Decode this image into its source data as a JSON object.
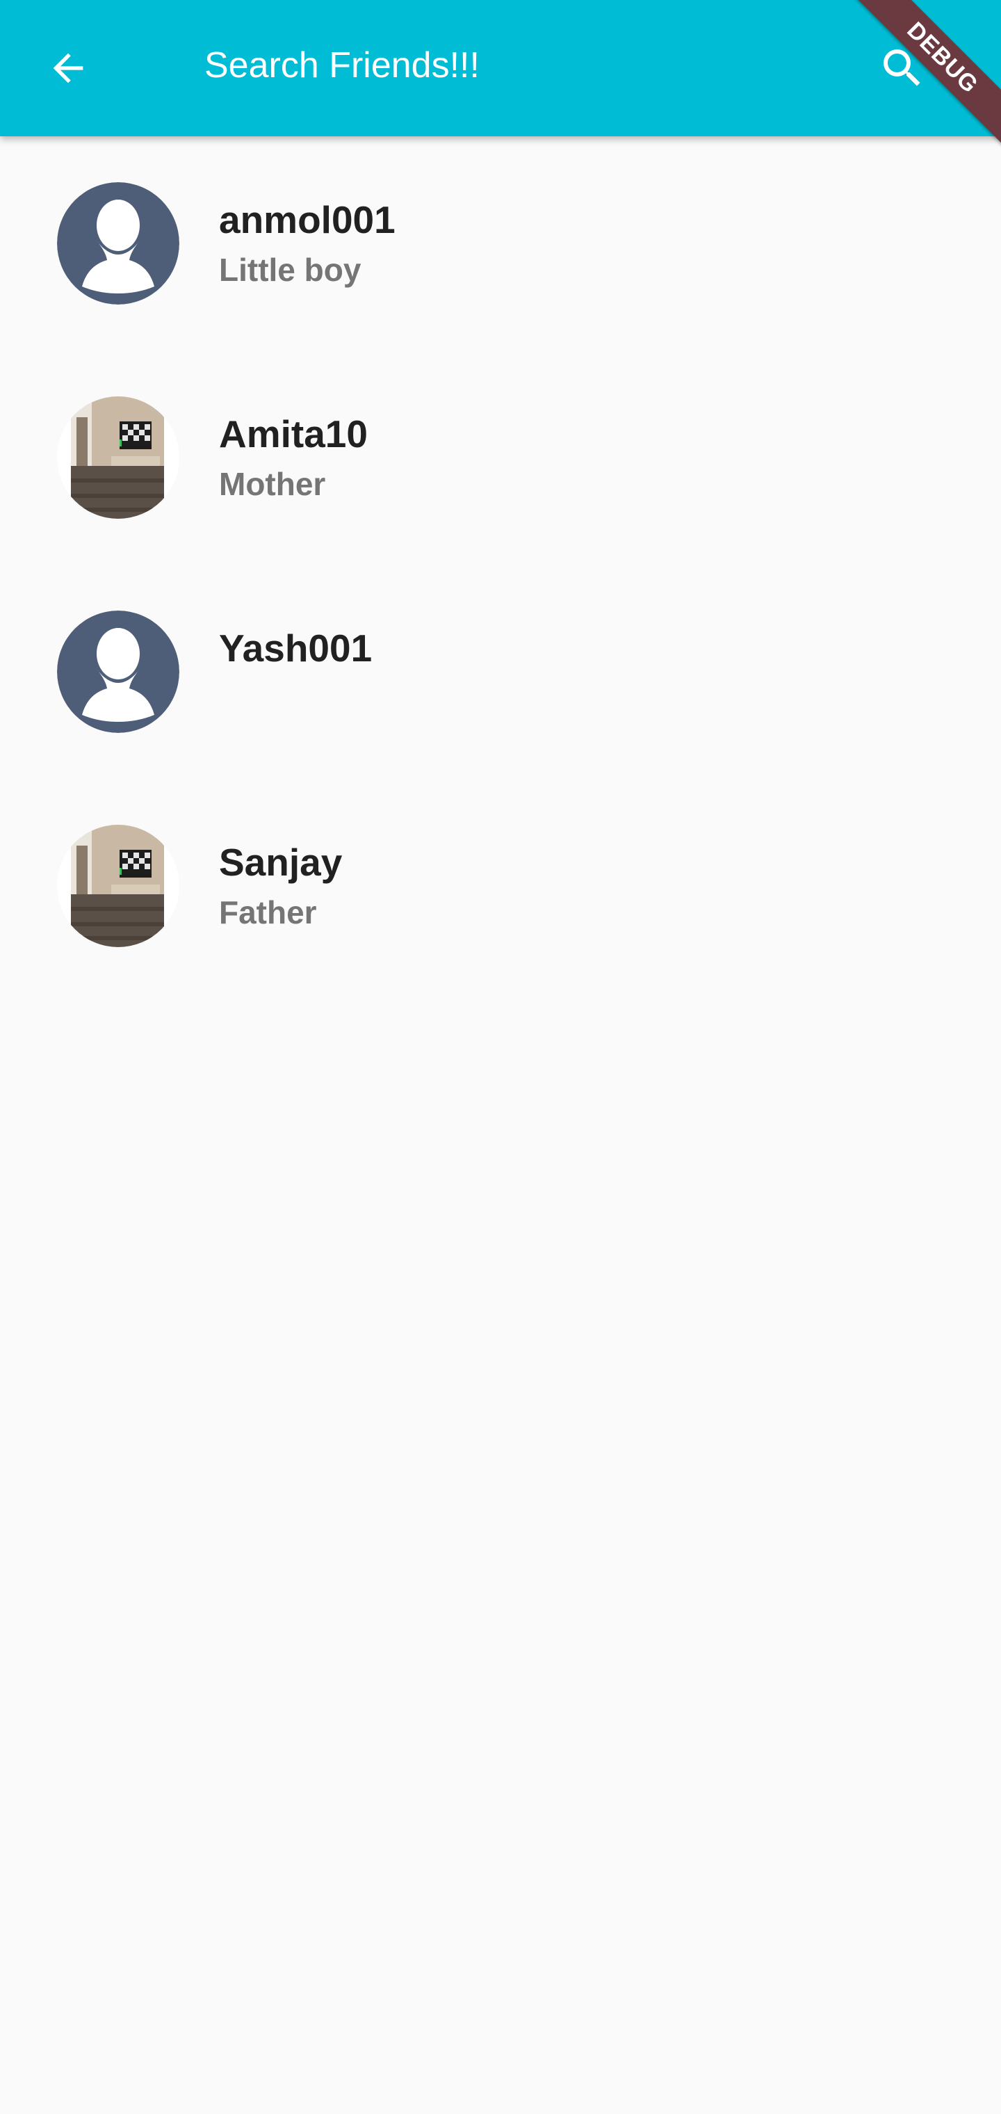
{
  "appbar": {
    "title": "Search Friends!!!",
    "back_icon": "arrow-back-icon",
    "search_icon": "search-icon",
    "color": "#00bcd4"
  },
  "debug_banner": {
    "label": "DEBUG"
  },
  "friends": [
    {
      "name": "anmol001",
      "relation": "Little boy",
      "avatar": "default-person-avatar"
    },
    {
      "name": "Amita10",
      "relation": "Mother",
      "avatar": "room-photo-avatar"
    },
    {
      "name": "Yash001",
      "relation": "",
      "avatar": "default-person-avatar"
    },
    {
      "name": "Sanjay",
      "relation": "Father",
      "avatar": "room-photo-avatar"
    }
  ]
}
